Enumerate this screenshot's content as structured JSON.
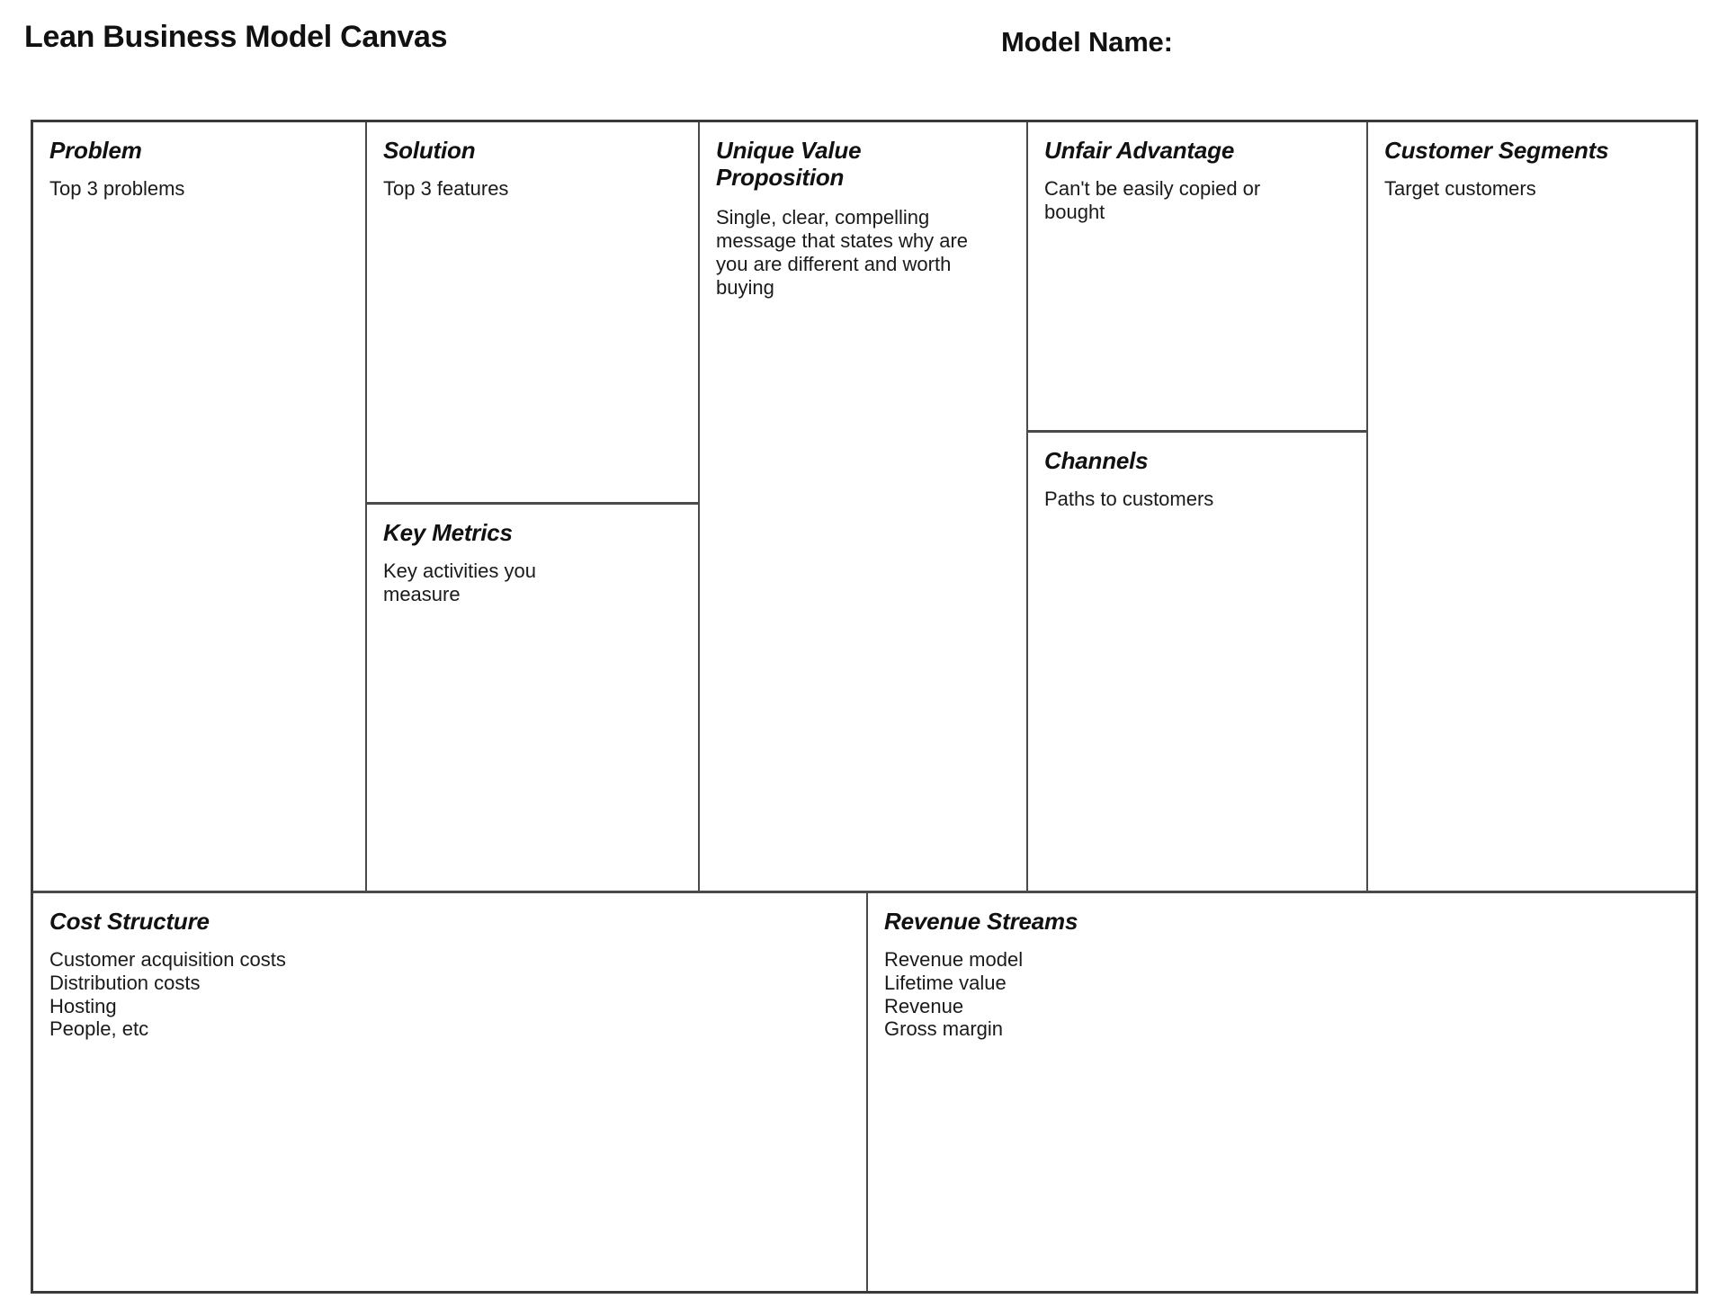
{
  "header": {
    "canvas_title": "Lean Business Model Canvas",
    "model_name_label": "Model Name:"
  },
  "blocks": {
    "problem": {
      "title": "Problem",
      "body": "Top 3 problems"
    },
    "solution": {
      "title": "Solution",
      "body": "Top 3 features"
    },
    "key_metrics": {
      "title": "Key Metrics",
      "body": "Key activities you measure"
    },
    "unique_value_proposition": {
      "title": "Unique Value Proposition",
      "body": "Single, clear, compelling message that states why are you are different and worth buying"
    },
    "unfair_advantage": {
      "title": "Unfair Advantage",
      "body": "Can't be easily copied or bought"
    },
    "channels": {
      "title": "Channels",
      "body": "Paths to customers"
    },
    "customer_segments": {
      "title": "Customer Segments",
      "body": "Target customers"
    },
    "cost_structure": {
      "title": "Cost Structure",
      "items": [
        "Customer acquisition costs",
        "Distribution costs",
        "Hosting",
        "People, etc"
      ]
    },
    "revenue_streams": {
      "title": "Revenue Streams",
      "items": [
        "Revenue model",
        "Lifetime value",
        "Revenue",
        "Gross margin"
      ]
    }
  },
  "colors": {
    "page_background": "#ffffff",
    "border_outer": "#3a3a3a",
    "border_inner": "#4a4a4a",
    "text": "#111111",
    "body_text": "#1a1a1a"
  }
}
